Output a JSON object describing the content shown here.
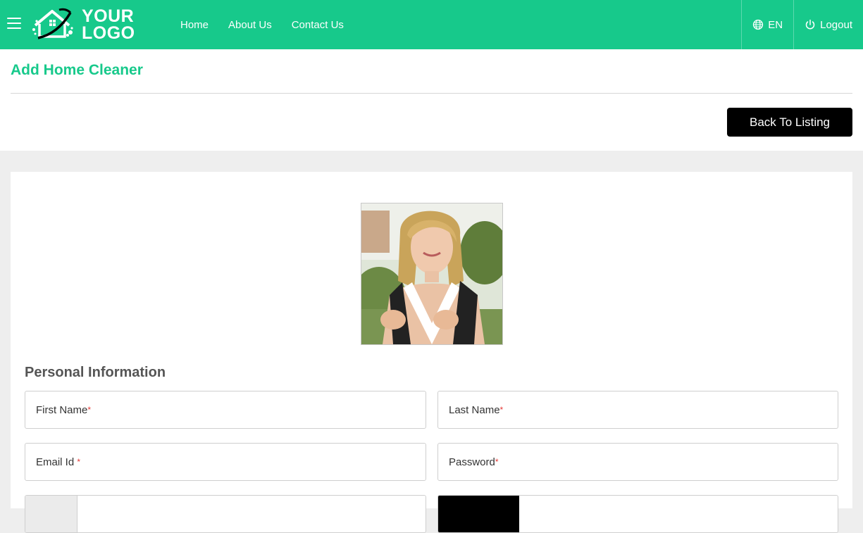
{
  "header": {
    "logo_line1": "YOUR",
    "logo_line2": "LOGO",
    "nav": [
      {
        "label": "Home"
      },
      {
        "label": "About Us"
      },
      {
        "label": "Contact Us"
      }
    ],
    "language": "EN",
    "logout": "Logout"
  },
  "page": {
    "title": "Add Home Cleaner",
    "back_button": "Back To Listing"
  },
  "form": {
    "section_title": "Personal Information",
    "first_name_label": "First Name",
    "last_name_label": "Last Name",
    "email_label": "Email Id",
    "password_label": "Password",
    "required_marker": "*"
  },
  "theme": {
    "accent": "#17c98b",
    "required": "#e53935"
  },
  "icons": [
    "hamburger-menu-icon",
    "globe-icon",
    "power-icon"
  ]
}
